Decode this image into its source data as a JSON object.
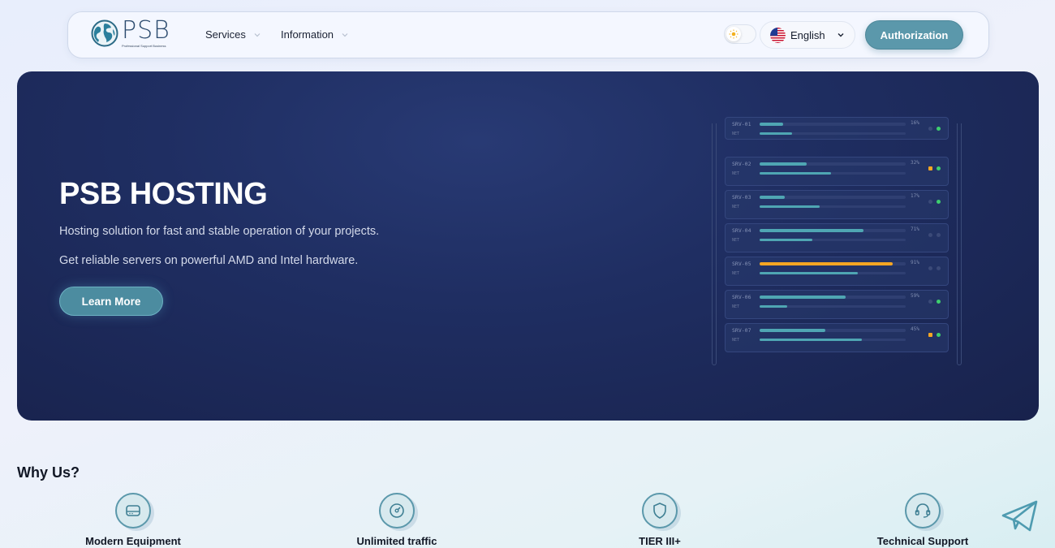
{
  "header": {
    "logo": {
      "wordmark": "PSB",
      "tagline": "Professional Support Business"
    },
    "nav": [
      {
        "label": "Services"
      },
      {
        "label": "Information"
      }
    ],
    "language": "English",
    "auth_label": "Authorization"
  },
  "hero": {
    "title": "PSB HOSTING",
    "line1": "Hosting solution for fast and stable operation of your projects.",
    "line2": "Get reliable servers on powerful AMD and Intel hardware.",
    "cta": "Learn More",
    "servers": [
      {
        "name": "SRV-01",
        "net_label": "NET",
        "load": 16,
        "pct": "16%",
        "net": 0.22,
        "status": "green"
      },
      {
        "name": "SRV-02",
        "net_label": "NET",
        "load": 32,
        "pct": "32%",
        "net": 0.49,
        "status": "amber-green"
      },
      {
        "name": "SRV-03",
        "net_label": "NET",
        "load": 17,
        "pct": "17%",
        "net": 0.41,
        "status": "green"
      },
      {
        "name": "SRV-04",
        "net_label": "NET",
        "load": 71,
        "pct": "71%",
        "net": 0.36,
        "status": "off"
      },
      {
        "name": "SRV-05",
        "net_label": "NET",
        "load": 91,
        "pct": "91%",
        "net": 0.67,
        "status": "off"
      },
      {
        "name": "SRV-06",
        "net_label": "NET",
        "load": 59,
        "pct": "59%",
        "net": 0.19,
        "status": "green"
      },
      {
        "name": "SRV-07",
        "net_label": "NET",
        "load": 45,
        "pct": "45%",
        "net": 0.7,
        "status": "amber-green"
      }
    ]
  },
  "why": {
    "title": "Why Us?",
    "features": [
      {
        "label": "Modern Equipment",
        "icon": "hard-drive-icon"
      },
      {
        "label": "Unlimited traffic",
        "icon": "speedometer-icon"
      },
      {
        "label": "TIER III+",
        "icon": "shield-icon"
      },
      {
        "label": "Technical Support",
        "icon": "headset-icon"
      }
    ]
  },
  "colors": {
    "accent": "#5b98ab",
    "hero_bg": "#1f2e62",
    "bar_normal": "#4fa6b3",
    "bar_high": "#f5a623",
    "led_green": "#3ecf6e",
    "led_amber": "#f5a623"
  }
}
